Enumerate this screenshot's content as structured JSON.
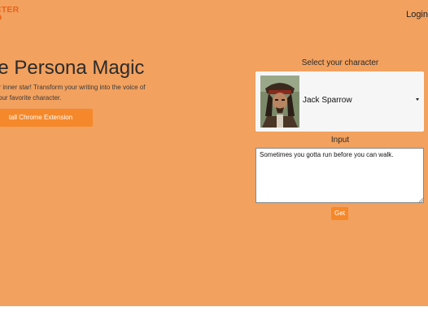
{
  "header": {
    "logo_line1": "CTER",
    "logo_line2": "O",
    "login_label": "Login"
  },
  "hero": {
    "headline": "ie Persona Magic",
    "subtext": "ur inner star! Transform your writing into the voice of your favorite character.",
    "install_button_label": "tall Chrome Extension"
  },
  "form": {
    "select_label": "Select your character",
    "selected_character": "Jack Sparrow",
    "input_label": "Input",
    "input_value": "Sometimes you gotta run before you can walk.",
    "get_button_label": "Get"
  },
  "colors": {
    "hero_background": "#f2a15f",
    "accent": "#f5882a",
    "logo": "#e8631a"
  },
  "icons": {
    "dropdown": "chevron-down-icon",
    "resize": "resize-grip-icon"
  }
}
